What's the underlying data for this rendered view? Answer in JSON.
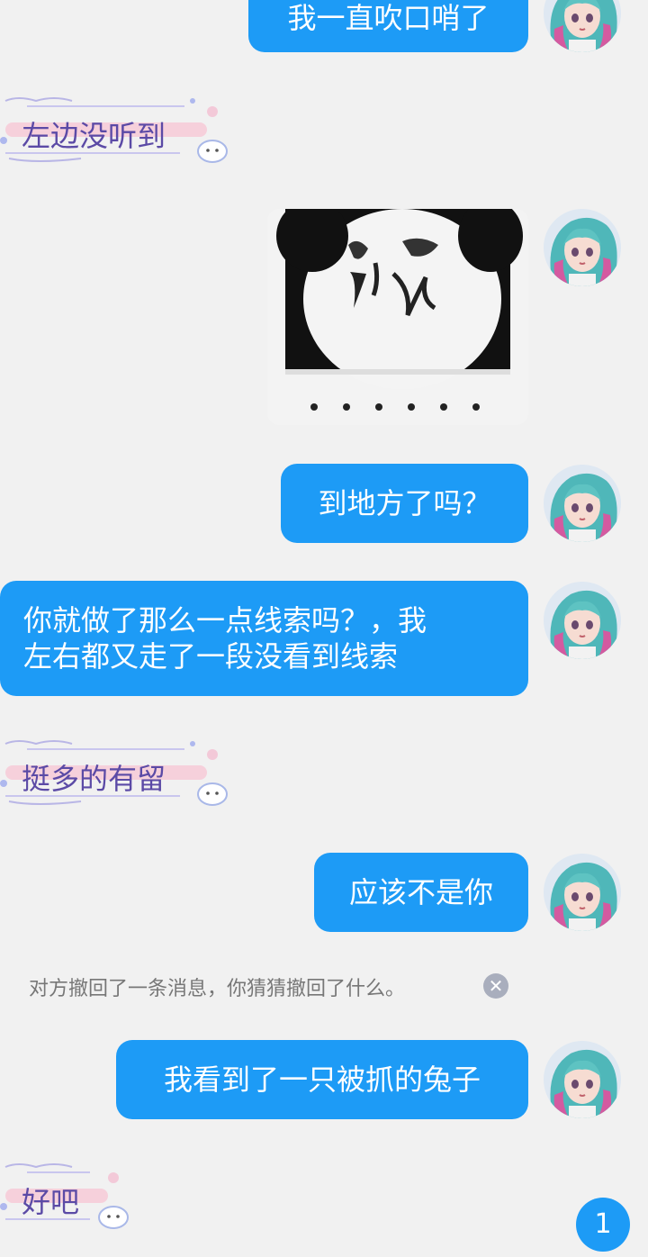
{
  "messages": {
    "out_1": "我一直吹口哨了",
    "in_1": "左边没听到",
    "out_3": "到地方了吗？",
    "out_4_line1": "你就做了那么一点线索吗？，我",
    "out_4_line2": "左右都又走了一段没看到线索",
    "in_2": "挺多的有留",
    "out_5": "应该不是你",
    "recall_notice": "对方撤回了一条消息，你猜猜撤回了什么。",
    "out_6": "我看到了一只被抓的兔子",
    "in_3": "好吧"
  },
  "unread_badge": "1",
  "colors": {
    "outgoing_bubble": "#1d9bf6",
    "incoming_text": "#5b4aa6",
    "background": "#f1f1f1"
  },
  "icons": {
    "recall_close": "close-circle-icon",
    "avatar": "anime-girl-avatar"
  }
}
